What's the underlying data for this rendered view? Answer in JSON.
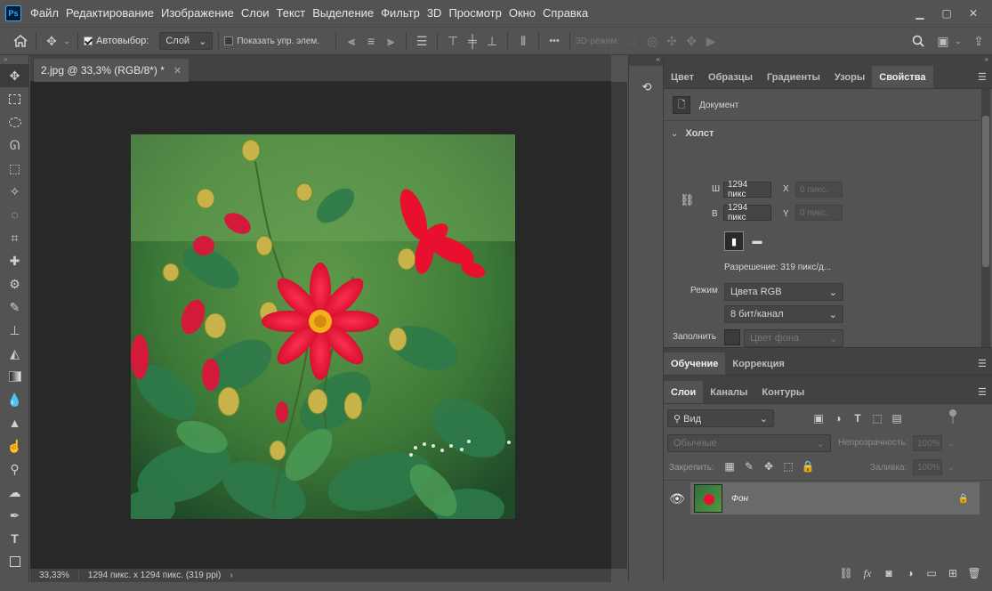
{
  "app": {
    "logo": "Ps"
  },
  "menu": [
    "Файл",
    "Редактирование",
    "Изображение",
    "Слои",
    "Текст",
    "Выделение",
    "Фильтр",
    "3D",
    "Просмотр",
    "Окно",
    "Справка"
  ],
  "options_bar": {
    "autoselect_label": "Автовыбор:",
    "autoselect_checked": true,
    "target_value": "Слой",
    "show_transform_label": "Показать упр. элем.",
    "more_label": "•••",
    "mode_3d_label": "3D-режим:"
  },
  "document": {
    "tab_title": "2.jpg @ 33,3% (RGB/8*) *",
    "zoom": "33,33%",
    "status_info": "1294 пикс. x 1294 пикс. (319 ppi)"
  },
  "properties_panel": {
    "tabs": [
      "Цвет",
      "Образцы",
      "Градиенты",
      "Узоры",
      "Свойства"
    ],
    "active_tab": "Свойства",
    "doc_label": "Документ",
    "canvas_section": "Холст",
    "width_label": "Ш",
    "width_value": "1294 пикс",
    "height_label": "В",
    "height_value": "1294 пикс",
    "x_label": "X",
    "x_value": "0 пикс.",
    "y_label": "Y",
    "y_value": "0 пикс.",
    "resolution": "Разрешение: 319 пикс/д...",
    "mode_label": "Режим",
    "mode_value": "Цвета RGB",
    "depth_value": "8 бит/канал",
    "fill_label": "Заполнить",
    "fill_value": "Цвет фона"
  },
  "learn_panel": {
    "tabs": [
      "Обучение",
      "Коррекция"
    ],
    "active_tab": "Обучение"
  },
  "layers_panel": {
    "tabs": [
      "Слои",
      "Каналы",
      "Контуры"
    ],
    "active_tab": "Слои",
    "filter_placeholder": "Вид",
    "blend_mode": "Обычные",
    "opacity_label": "Непрозрачность:",
    "opacity_value": "100%",
    "lock_label": "Закрепить:",
    "fill_label": "Заливка:",
    "fill_value": "100%",
    "layers": [
      {
        "name": "Фон",
        "visible": true,
        "locked": true
      }
    ]
  },
  "colors": {
    "accent": "#31a8ff",
    "bg": "#535353",
    "canvas_bg": "#282828"
  }
}
